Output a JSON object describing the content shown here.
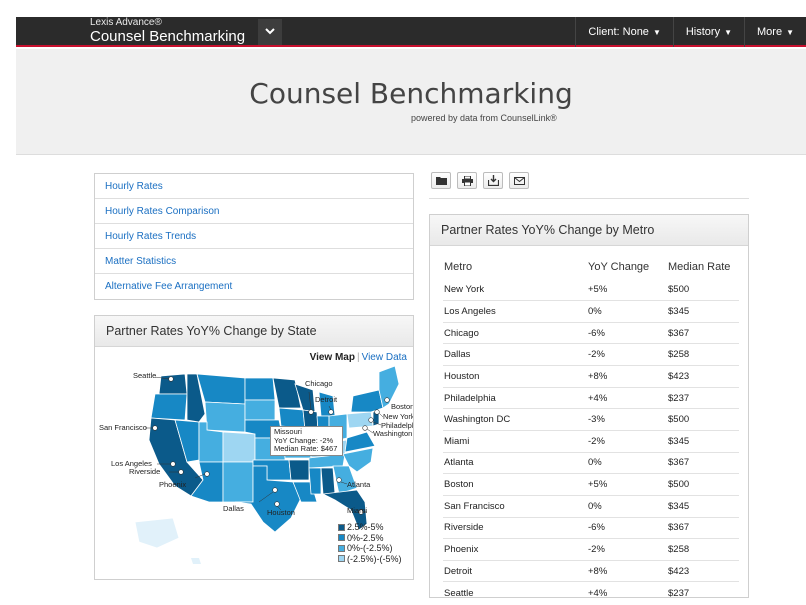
{
  "topbar": {
    "brand_sup": "Lexis Advance®",
    "brand_main": "Counsel Benchmarking",
    "nav": [
      {
        "label": "Client: None"
      },
      {
        "label": "History"
      },
      {
        "label": "More"
      }
    ]
  },
  "hero": {
    "title": "Counsel Benchmarking",
    "subtitle": "powered by data from CounselLink®"
  },
  "menu": [
    "Hourly Rates",
    "Hourly Rates Comparison",
    "Hourly Rates Trends",
    "Matter Statistics",
    "Alternative Fee Arrangement"
  ],
  "state_panel": {
    "title": "Partner Rates YoY% Change by State",
    "view_map": "View Map",
    "view_data": "View Data",
    "cities": [
      "Seattle",
      "Chicago",
      "Detroit",
      "Boston",
      "New York",
      "Philadelphia",
      "Washington DC",
      "San Francisco",
      "Los Angeles",
      "Riverside",
      "Phoenix",
      "Atlanta",
      "Dallas",
      "Houston",
      "Miami"
    ],
    "tooltip": {
      "state": "Missouri",
      "change": "YoY Change: -2%",
      "median": "Median Rate: $467"
    },
    "legend": [
      {
        "label": "2.5%-5%",
        "color": "#0b5a8a"
      },
      {
        "label": "0%-2.5%",
        "color": "#1788c5"
      },
      {
        "label": "0%-(-2.5%)",
        "color": "#45aee0"
      },
      {
        "label": "(-2.5%)-(-5%)",
        "color": "#9ed6f2"
      }
    ]
  },
  "tools": [
    "folder-icon",
    "print-icon",
    "download-icon",
    "email-icon"
  ],
  "metro_panel": {
    "title": "Partner Rates YoY% Change by Metro",
    "headers": [
      "Metro",
      "YoY Change",
      "Median Rate"
    ],
    "rows": [
      [
        "New York",
        "+5%",
        "$500"
      ],
      [
        "Los Angeles",
        "0%",
        "$345"
      ],
      [
        "Chicago",
        "-6%",
        "$367"
      ],
      [
        "Dallas",
        "-2%",
        "$258"
      ],
      [
        "Houston",
        "+8%",
        "$423"
      ],
      [
        "Philadelphia",
        "+4%",
        "$237"
      ],
      [
        "Washington DC",
        "-3%",
        "$500"
      ],
      [
        "Miami",
        "-2%",
        "$345"
      ],
      [
        "Atlanta",
        "0%",
        "$367"
      ],
      [
        "Boston",
        "+5%",
        "$500"
      ],
      [
        "San Francisco",
        "0%",
        "$345"
      ],
      [
        "Riverside",
        "-6%",
        "$367"
      ],
      [
        "Phoenix",
        "-2%",
        "$258"
      ],
      [
        "Detroit",
        "+8%",
        "$423"
      ],
      [
        "Seattle",
        "+4%",
        "$237"
      ]
    ]
  }
}
